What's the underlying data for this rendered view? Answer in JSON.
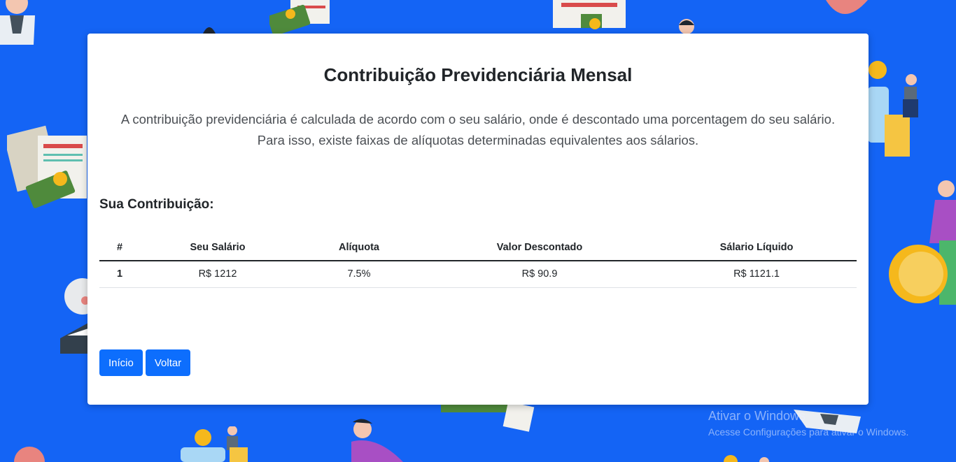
{
  "page": {
    "title": "Contribuição Previdenciária Mensal",
    "intro": "A contribuição previdenciária é calculada de acordo com o seu salário, onde é descontado uma porcentagem do seu salário. Para isso, existe faixas de alíquotas determinadas equivalentes aos sálarios.",
    "subtitle": "Sua Contribuição:"
  },
  "table": {
    "headers": [
      "#",
      "Seu Salário",
      "Alíquota",
      "Valor Descontado",
      "Sálario Líquido"
    ],
    "rows": [
      [
        "1",
        "R$ 1212",
        "7.5%",
        "R$ 90.9",
        "R$ 1121.1"
      ]
    ]
  },
  "buttons": {
    "home": "Início",
    "back": "Voltar"
  },
  "watermark": {
    "title": "Ativar o Windows",
    "subtitle": "Acesse Configurações para ativar o Windows."
  },
  "colors": {
    "background": "#1464f5",
    "primary_button": "#0d6efd",
    "card": "#ffffff"
  }
}
